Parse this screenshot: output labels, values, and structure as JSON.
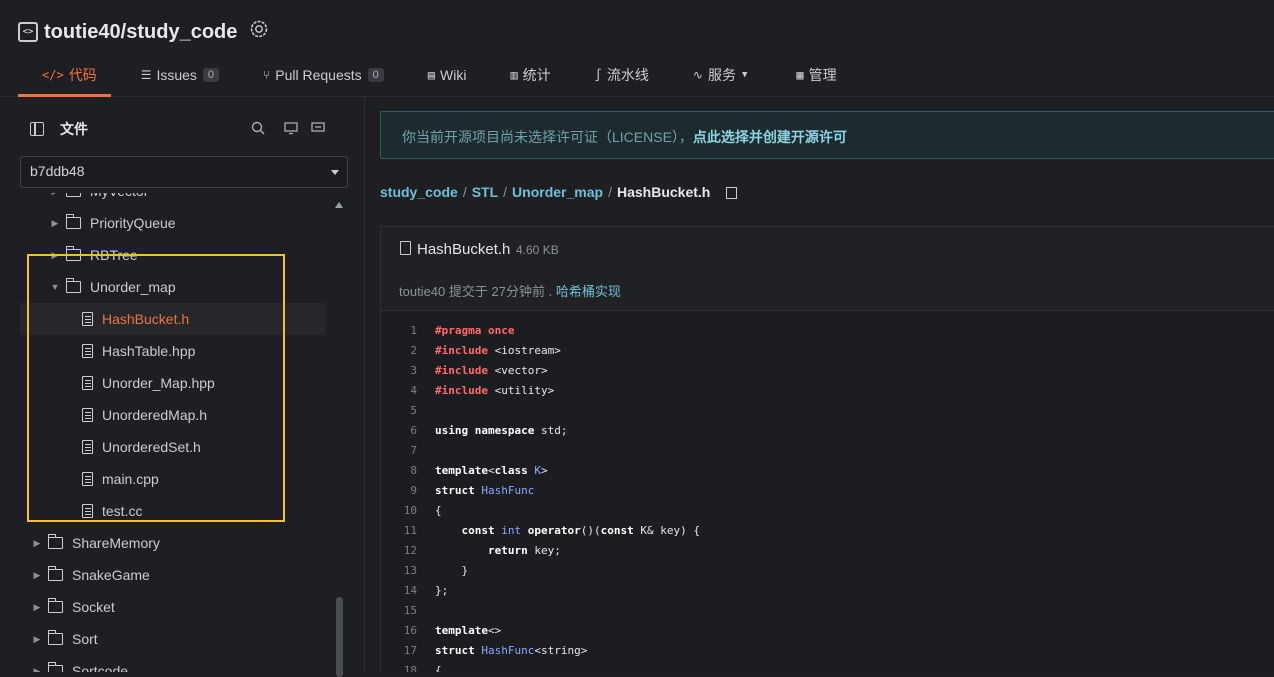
{
  "repo": {
    "title": "toutie40/study_code"
  },
  "tabs": [
    {
      "label": "代码",
      "icon": "code-icon",
      "count": null,
      "active": true
    },
    {
      "label": "Issues",
      "icon": "issues-icon",
      "count": "0"
    },
    {
      "label": "Pull Requests",
      "icon": "pull-request-icon",
      "count": "0"
    },
    {
      "label": "Wiki",
      "icon": "wiki-icon",
      "count": null
    },
    {
      "label": "统计",
      "icon": "stats-icon",
      "count": null
    },
    {
      "label": "流水线",
      "icon": "pipeline-icon",
      "count": null
    },
    {
      "label": "服务",
      "icon": "service-icon",
      "count": null,
      "dropdown": true
    },
    {
      "label": "管理",
      "icon": "manage-icon",
      "count": null
    }
  ],
  "sidebar": {
    "title": "文件",
    "branch": "b7ddb48",
    "tree": [
      {
        "name": "MyVector",
        "type": "folder",
        "depth": 1
      },
      {
        "name": "PriorityQueue",
        "type": "folder",
        "depth": 1,
        "expanded": false
      },
      {
        "name": "RBTree",
        "type": "folder",
        "depth": 1,
        "expanded": false
      },
      {
        "name": "Unorder_map",
        "type": "folder",
        "depth": 1,
        "expanded": true
      },
      {
        "name": "HashBucket.h",
        "type": "file",
        "depth": 2,
        "selected": true
      },
      {
        "name": "HashTable.hpp",
        "type": "file",
        "depth": 2
      },
      {
        "name": "Unorder_Map.hpp",
        "type": "file",
        "depth": 2
      },
      {
        "name": "UnorderedMap.h",
        "type": "file",
        "depth": 2
      },
      {
        "name": "UnorderedSet.h",
        "type": "file",
        "depth": 2
      },
      {
        "name": "main.cpp",
        "type": "file",
        "depth": 2
      },
      {
        "name": "test.cc",
        "type": "file",
        "depth": 2
      },
      {
        "name": "ShareMemory",
        "type": "folder",
        "depth": 0,
        "expanded": false
      },
      {
        "name": "SnakeGame",
        "type": "folder",
        "depth": 0,
        "expanded": false
      },
      {
        "name": "Socket",
        "type": "folder",
        "depth": 0,
        "expanded": false
      },
      {
        "name": "Sort",
        "type": "folder",
        "depth": 0,
        "expanded": false
      },
      {
        "name": "Sortcode",
        "type": "folder",
        "depth": 0,
        "expanded": false
      }
    ]
  },
  "notice": {
    "text": "你当前开源项目尚未选择许可证（LICENSE），",
    "link": "点此选择并创建开源许可"
  },
  "breadcrumb": {
    "parts": [
      "study_code",
      "STL",
      "Unorder_map"
    ],
    "current": "HashBucket.h"
  },
  "file": {
    "name": "HashBucket.h",
    "size": "4.60 KB",
    "commit_author": "toutie40",
    "commit_meta": "提交于 27分钟前 .",
    "commit_message": "哈希桶实现"
  },
  "code_lines": [
    {
      "n": "1",
      "html": "<span class=\"pp\">#pragma once</span>"
    },
    {
      "n": "2",
      "html": "<span class=\"pp\">#include</span> &lt;iostream&gt;"
    },
    {
      "n": "3",
      "html": "<span class=\"pp\">#include</span> &lt;vector&gt;"
    },
    {
      "n": "4",
      "html": "<span class=\"pp\">#include</span> &lt;utility&gt;"
    },
    {
      "n": "5",
      "html": ""
    },
    {
      "n": "6",
      "html": "<span class=\"kw\">using namespace</span> std;"
    },
    {
      "n": "7",
      "html": ""
    },
    {
      "n": "8",
      "html": "<span class=\"kw\">template</span>&lt;<span class=\"kw\">class</span> <span class=\"tp\">K</span>&gt;"
    },
    {
      "n": "9",
      "html": "<span class=\"kw\">struct</span> <span class=\"tp\">HashFunc</span>"
    },
    {
      "n": "10",
      "html": "{"
    },
    {
      "n": "11",
      "html": "    <span class=\"kw\">const</span> <span class=\"tp\">int</span> <span class=\"kw\">operator</span>()(<span class=\"kw\">const</span> K&amp; key) {"
    },
    {
      "n": "12",
      "html": "        <span class=\"kw\">return</span> key;"
    },
    {
      "n": "13",
      "html": "    }"
    },
    {
      "n": "14",
      "html": "};"
    },
    {
      "n": "15",
      "html": ""
    },
    {
      "n": "16",
      "html": "<span class=\"kw\">template</span>&lt;&gt;"
    },
    {
      "n": "17",
      "html": "<span class=\"kw\">struct</span> <span class=\"tp\">HashFunc</span>&lt;string&gt;"
    },
    {
      "n": "18",
      "html": "{"
    }
  ],
  "colors": {
    "accent": "#f0743c",
    "link": "#6fc0d6",
    "highlight_box": "#f5c028"
  }
}
